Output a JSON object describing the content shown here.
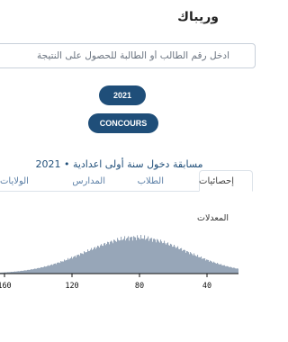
{
  "header": {
    "title": "وريباك"
  },
  "search": {
    "placeholder": "ادخل رقم الطالب أو الطالبة للحصول على النتيجة"
  },
  "filters": {
    "year_label": "2021",
    "exam_label": "CONCOURS"
  },
  "exam": {
    "title": "مسابقة دخول سنة أولى اعدادية • 2021"
  },
  "tabs": [
    {
      "label": "إحصائيات"
    },
    {
      "label": "الطلاب"
    },
    {
      "label": "المدارس"
    },
    {
      "label": "الولايات"
    }
  ],
  "chart_data": {
    "type": "bar",
    "ylabel": "المعدلات",
    "x_ticks": [
      "160",
      "120",
      "80",
      "40"
    ],
    "x_reversed": true,
    "xlim": [
      0,
      200
    ],
    "color": "#97a6b8",
    "shape": "bell-shaped distribution of student averages (histogram), peak near 80"
  },
  "colors": {
    "accent": "#1f4e79",
    "bars": "#97a6b8",
    "border": "#c8d0da"
  }
}
